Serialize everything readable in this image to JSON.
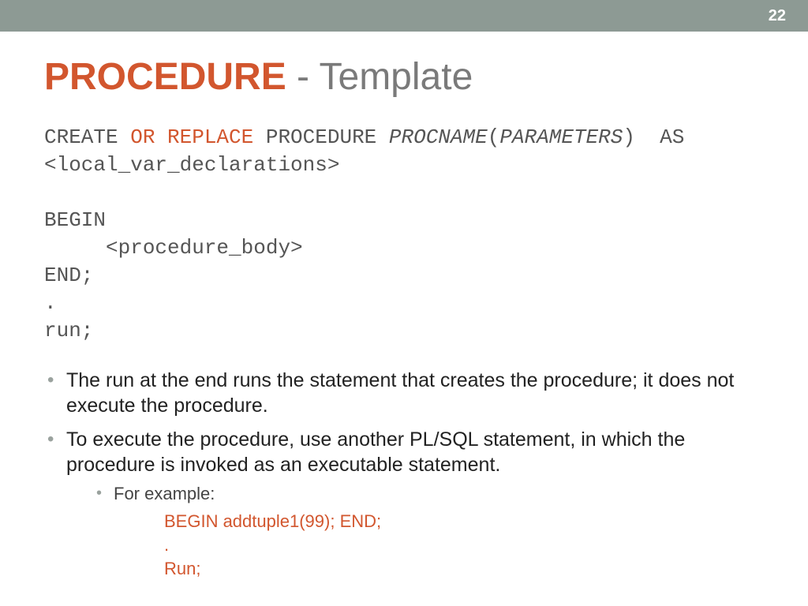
{
  "page_number": "22",
  "title": {
    "strong": "PROCEDURE",
    "rest": " - Template"
  },
  "code": {
    "l1a": "CREATE ",
    "l1b": "OR REPLACE",
    "l1c": " PROCEDURE ",
    "l1d": "PROCNAME",
    "l1e": "(",
    "l1f": "PARAMETERS",
    "l1g": ")  AS",
    "l2": "<local_var_declarations>",
    "l3": "",
    "l4": "BEGIN",
    "l5": "     <procedure_body>",
    "l6": "END;",
    "l7": ".",
    "l8": "run;"
  },
  "bullets": {
    "b1": "The run at the end runs the statement that creates the procedure; it does not execute the procedure.",
    "b2": "To execute the procedure, use another PL/SQL statement, in which the procedure is invoked as an executable statement.",
    "sub1": "For example:",
    "ex1": "BEGIN addtuple1(99); END;",
    "ex2": ".",
    "ex3": "Run;"
  }
}
